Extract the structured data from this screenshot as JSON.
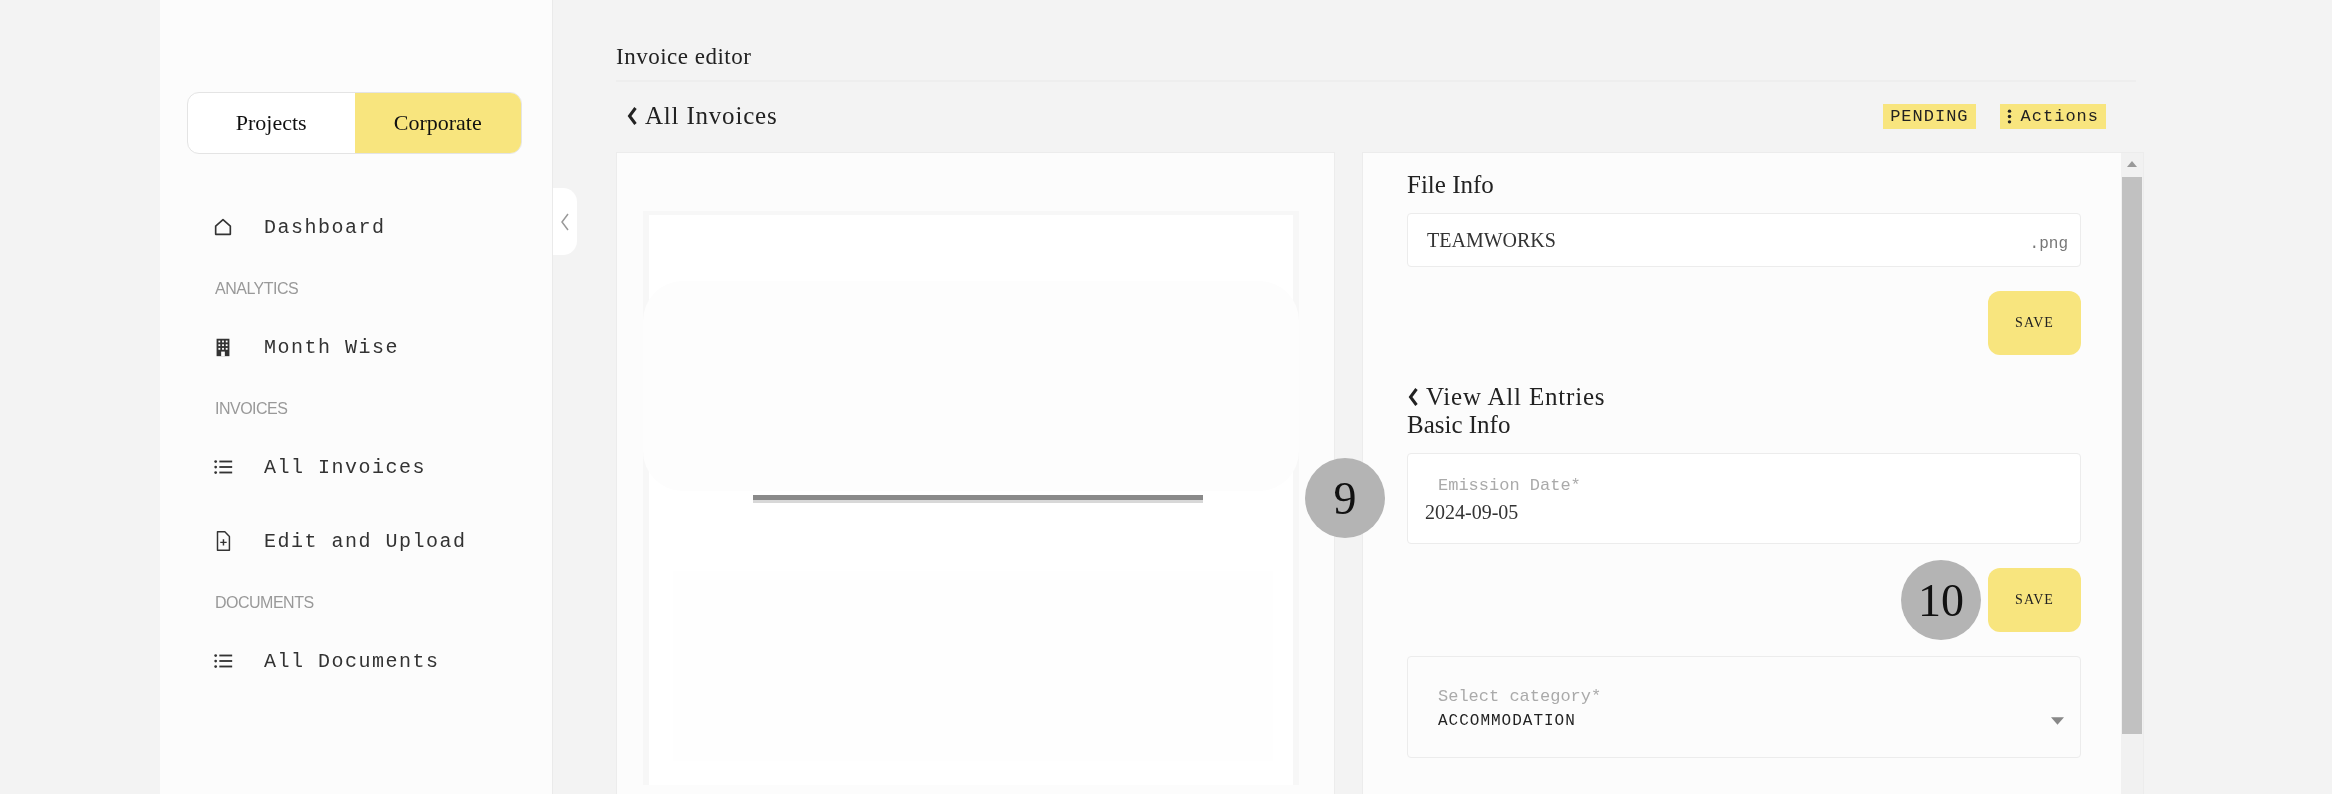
{
  "sidebar": {
    "toggle": [
      {
        "label": "Projects",
        "selected": false
      },
      {
        "label": "Corporate",
        "selected": true
      }
    ],
    "items": [
      {
        "kind": "link",
        "label": "Dashboard"
      },
      {
        "kind": "section",
        "label": "ANALYTICS"
      },
      {
        "kind": "link",
        "label": "Month Wise"
      },
      {
        "kind": "section",
        "label": "INVOICES"
      },
      {
        "kind": "link",
        "label": "All Invoices"
      },
      {
        "kind": "link",
        "label": "Edit and Upload"
      },
      {
        "kind": "section",
        "label": "DOCUMENTS"
      },
      {
        "kind": "link",
        "label": "All Documents"
      }
    ]
  },
  "main": {
    "title": "Invoice editor",
    "back_link": "All Invoices",
    "status": "PENDING",
    "actions": "Actions",
    "file_info": {
      "title": "File Info",
      "file_name": "TEAMWORKS",
      "extension": ".png",
      "save": "SAVE"
    },
    "entries_link": "View All Entries",
    "basic_info": {
      "title": "Basic Info",
      "date_field": {
        "label": "Emission Date*",
        "value": "2024-09-05"
      },
      "save": "SAVE",
      "category_field": {
        "label": "Select category*",
        "value": "ACCOMMODATION"
      }
    }
  },
  "markers": [
    {
      "label": "9"
    },
    {
      "label": "10"
    }
  ]
}
